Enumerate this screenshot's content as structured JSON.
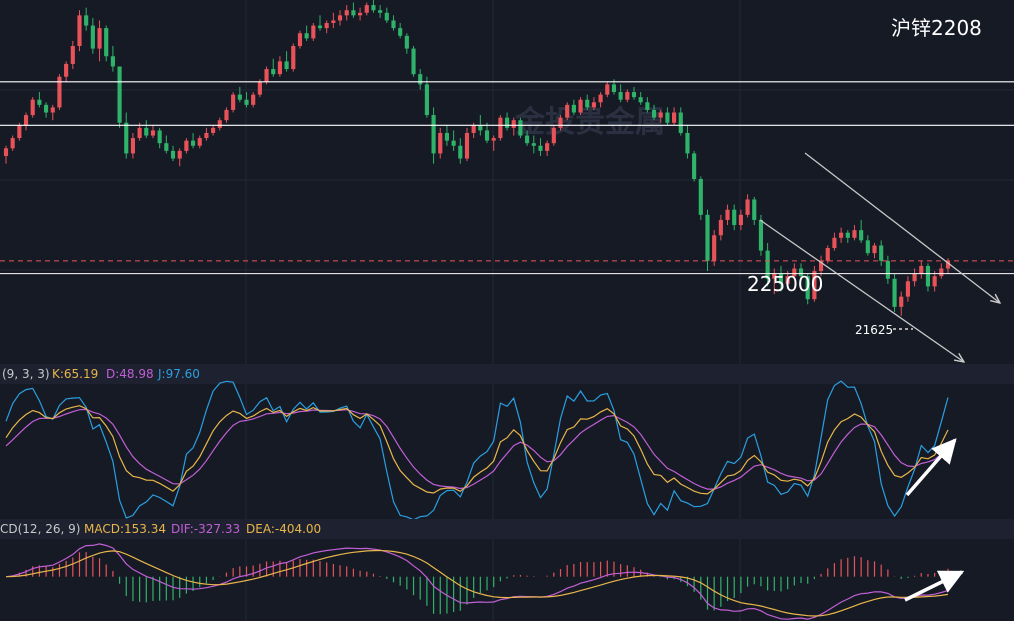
{
  "colors": {
    "background": "#161a25",
    "up": "#e8535a",
    "down": "#2fb36a",
    "k_line": "#e8b64a",
    "d_line": "#c15fd6",
    "j_line": "#2a9fe0",
    "hist_up": "#e8535a",
    "hist_down": "#2fb36a",
    "label_white": "#ffffff",
    "dashed_ref": "#e8535a",
    "arrow": "#ffffff"
  },
  "chart_data": [
    {
      "type": "candlestick",
      "title": "沪锌2208",
      "ylim": [
        20800,
        27800
      ],
      "watermark": "金投贵金属",
      "series": [
        {
          "ohlc": [
            [
              24750,
              24950,
              24600,
              24900
            ],
            [
              24900,
              25150,
              24850,
              25100
            ],
            [
              25100,
              25400,
              25050,
              25350
            ],
            [
              25350,
              25600,
              25250,
              25550
            ],
            [
              25550,
              25900,
              25500,
              25850
            ],
            [
              25850,
              26000,
              25700,
              25750
            ],
            [
              25750,
              25800,
              25500,
              25600
            ],
            [
              25600,
              25750,
              25450,
              25700
            ],
            [
              25700,
              26350,
              25650,
              26300
            ],
            [
              26300,
              26600,
              26200,
              26550
            ],
            [
              26550,
              27000,
              26450,
              26900
            ],
            [
              26900,
              27600,
              26800,
              27500
            ],
            [
              27500,
              27650,
              27200,
              27300
            ],
            [
              27300,
              27450,
              26750,
              26850
            ],
            [
              26850,
              27400,
              26600,
              27250
            ],
            [
              27250,
              27300,
              26600,
              26700
            ],
            [
              26700,
              26900,
              26400,
              26500
            ],
            [
              26500,
              26500,
              25300,
              25400
            ],
            [
              25400,
              25600,
              24700,
              24800
            ],
            [
              24800,
              25200,
              24700,
              25100
            ],
            [
              25100,
              25400,
              25050,
              25300
            ],
            [
              25300,
              25450,
              25100,
              25150
            ],
            [
              25150,
              25350,
              25100,
              25250
            ],
            [
              25250,
              25300,
              24900,
              25000
            ],
            [
              25000,
              25150,
              24800,
              24850
            ],
            [
              24850,
              24950,
              24650,
              24700
            ],
            [
              24700,
              24900,
              24550,
              24850
            ],
            [
              24850,
              25100,
              24800,
              25050
            ],
            [
              25050,
              25200,
              24900,
              24950
            ],
            [
              24950,
              25150,
              24900,
              25100
            ],
            [
              25100,
              25300,
              25050,
              25200
            ],
            [
              25200,
              25350,
              25150,
              25300
            ],
            [
              25300,
              25500,
              25250,
              25450
            ],
            [
              25450,
              25700,
              25400,
              25650
            ],
            [
              25650,
              26000,
              25600,
              25950
            ],
            [
              25950,
              26100,
              25800,
              25850
            ],
            [
              25850,
              26000,
              25700,
              25750
            ],
            [
              25750,
              26000,
              25700,
              25950
            ],
            [
              25950,
              26250,
              25900,
              26200
            ],
            [
              26200,
              26500,
              26150,
              26450
            ],
            [
              26450,
              26650,
              26300,
              26350
            ],
            [
              26350,
              26700,
              26300,
              26600
            ],
            [
              26600,
              26800,
              26400,
              26450
            ],
            [
              26450,
              26950,
              26400,
              26900
            ],
            [
              26900,
              27200,
              26850,
              27150
            ],
            [
              27150,
              27300,
              27000,
              27050
            ],
            [
              27050,
              27350,
              27000,
              27300
            ],
            [
              27300,
              27500,
              27200,
              27250
            ],
            [
              27250,
              27400,
              27150,
              27350
            ],
            [
              27350,
              27550,
              27250,
              27400
            ],
            [
              27400,
              27600,
              27300,
              27500
            ],
            [
              27500,
              27700,
              27400,
              27600
            ],
            [
              27600,
              27750,
              27450,
              27500
            ],
            [
              27500,
              27650,
              27400,
              27550
            ],
            [
              27550,
              27750,
              27500,
              27700
            ],
            [
              27700,
              27800,
              27550,
              27600
            ],
            [
              27600,
              27700,
              27450,
              27550
            ],
            [
              27550,
              27650,
              27350,
              27400
            ],
            [
              27400,
              27500,
              27200,
              27250
            ],
            [
              27250,
              27350,
              27050,
              27100
            ],
            [
              27100,
              27150,
              26750,
              26850
            ],
            [
              26850,
              26900,
              26300,
              26350
            ],
            [
              26350,
              26450,
              26050,
              26150
            ],
            [
              26150,
              26300,
              25500,
              25550
            ],
            [
              25550,
              25700,
              24600,
              24800
            ],
            [
              24800,
              25300,
              24700,
              25200
            ],
            [
              25200,
              25350,
              24950,
              25050
            ],
            [
              25050,
              25250,
              24850,
              24950
            ],
            [
              24950,
              25100,
              24600,
              24700
            ],
            [
              24700,
              25300,
              24650,
              25200
            ],
            [
              25200,
              25400,
              25100,
              25350
            ],
            [
              25350,
              25550,
              25150,
              25250
            ],
            [
              25250,
              25400,
              25000,
              25050
            ],
            [
              25050,
              25150,
              24850,
              25100
            ],
            [
              25100,
              25550,
              25050,
              25500
            ],
            [
              25500,
              25600,
              25250,
              25300
            ],
            [
              25300,
              25500,
              25150,
              25450
            ],
            [
              25450,
              25500,
              25100,
              25150
            ],
            [
              25150,
              25250,
              24950,
              25000
            ],
            [
              25000,
              25150,
              24800,
              24950
            ],
            [
              24950,
              25100,
              24750,
              24850
            ],
            [
              24850,
              25050,
              24750,
              25000
            ],
            [
              25000,
              25350,
              24950,
              25300
            ],
            [
              25300,
              25550,
              25250,
              25500
            ],
            [
              25500,
              25800,
              25450,
              25750
            ],
            [
              25750,
              25850,
              25550,
              25600
            ],
            [
              25600,
              25900,
              25550,
              25850
            ],
            [
              25850,
              25950,
              25650,
              25700
            ],
            [
              25700,
              25900,
              25650,
              25800
            ],
            [
              25800,
              26000,
              25700,
              25950
            ],
            [
              25950,
              26200,
              25900,
              26150
            ],
            [
              26150,
              26250,
              25950,
              26000
            ],
            [
              26000,
              26150,
              25800,
              25850
            ],
            [
              25850,
              26050,
              25800,
              26000
            ],
            [
              26000,
              26100,
              25850,
              25900
            ],
            [
              25900,
              26000,
              25750,
              25800
            ],
            [
              25800,
              25900,
              25600,
              25650
            ],
            [
              25650,
              25750,
              25450,
              25500
            ],
            [
              25500,
              25650,
              25400,
              25600
            ],
            [
              25600,
              25700,
              25350,
              25400
            ],
            [
              25400,
              25700,
              25350,
              25600
            ],
            [
              25600,
              25700,
              25150,
              25200
            ],
            [
              25200,
              25350,
              24700,
              24800
            ],
            [
              24800,
              24850,
              24250,
              24300
            ],
            [
              24300,
              24350,
              23500,
              23600
            ],
            [
              23600,
              23700,
              22500,
              22700
            ],
            [
              22700,
              23300,
              22600,
              23200
            ],
            [
              23200,
              23600,
              23100,
              23500
            ],
            [
              23500,
              23800,
              23400,
              23700
            ],
            [
              23700,
              23800,
              23300,
              23400
            ],
            [
              23400,
              23700,
              23300,
              23600
            ],
            [
              23600,
              24000,
              23550,
              23900
            ],
            [
              23900,
              23950,
              23400,
              23500
            ],
            [
              23500,
              23600,
              22800,
              22900
            ],
            [
              22900,
              23050,
              22200,
              22350
            ],
            [
              22350,
              22550,
              22050,
              22450
            ],
            [
              22450,
              22600,
              22100,
              22250
            ],
            [
              22250,
              22500,
              22150,
              22400
            ],
            [
              22400,
              22650,
              22350,
              22550
            ],
            [
              22550,
              22650,
              22300,
              22400
            ],
            [
              22400,
              22450,
              21850,
              21950
            ],
            [
              21950,
              22600,
              21900,
              22500
            ],
            [
              22500,
              22800,
              22400,
              22700
            ],
            [
              22700,
              23000,
              22650,
              22950
            ],
            [
              22950,
              23250,
              22900,
              23150
            ],
            [
              23150,
              23350,
              23050,
              23250
            ],
            [
              23250,
              23300,
              23050,
              23150
            ],
            [
              23150,
              23400,
              23100,
              23300
            ],
            [
              23300,
              23500,
              23050,
              23100
            ],
            [
              23100,
              23200,
              22800,
              22850
            ],
            [
              22850,
              23050,
              22750,
              23000
            ],
            [
              23000,
              23100,
              22600,
              22700
            ],
            [
              22700,
              22800,
              22250,
              22350
            ],
            [
              22350,
              22450,
              21700,
              21800
            ],
            [
              21800,
              22100,
              21625,
              22000
            ],
            [
              22000,
              22400,
              21900,
              22300
            ],
            [
              22300,
              22550,
              22200,
              22450
            ],
            [
              22450,
              22700,
              22350,
              22600
            ],
            [
              22600,
              22650,
              22100,
              22200
            ],
            [
              22200,
              22500,
              22100,
              22400
            ],
            [
              22400,
              22650,
              22350,
              22550
            ],
            [
              22550,
              22750,
              22450,
              22700
            ]
          ]
        }
      ],
      "h_levels": [
        26200,
        25350,
        22450
      ],
      "dashed_level": 22700,
      "labels": {
        "support_value": "225000",
        "low_value": "21625"
      }
    },
    {
      "type": "line",
      "name": "KDJ",
      "header": {
        "params": "(9, 3, 3)",
        "k_label": "K:65.19",
        "d_label": "D:48.98",
        "j_label": "J:97.60"
      },
      "ylim": [
        -10,
        110
      ],
      "last": {
        "K": 65.19,
        "D": 48.98,
        "J": 97.6
      }
    },
    {
      "type": "line",
      "name": "MACD",
      "header": {
        "params": "CD(12, 26, 9)",
        "macd_label": "MACD:153.34",
        "dif_label": "DIF:-327.33",
        "dea_label": "DEA:-404.00"
      },
      "ylim": [
        -700,
        600
      ],
      "last": {
        "MACD": 153.34,
        "DIF": -327.33,
        "DEA": -404.0
      }
    }
  ]
}
